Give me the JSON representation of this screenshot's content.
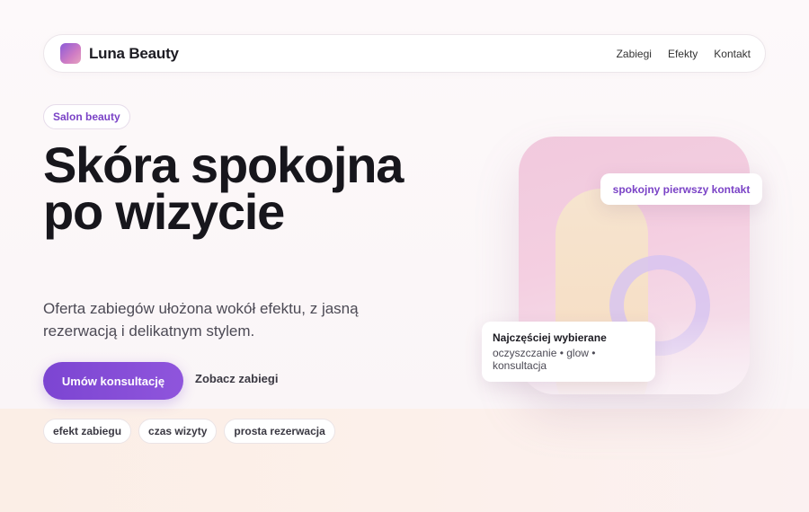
{
  "brand": {
    "name": "Luna Beauty"
  },
  "nav": {
    "links": [
      "Zabiegi",
      "Efekty",
      "Kontakt"
    ]
  },
  "hero": {
    "badge": "Salon beauty",
    "headline": "Skóra spokojna po wizycie",
    "subtitle": "Oferta zabiegów ułożona wokół efektu, z jasną rezerwacją i delikatnym stylem.",
    "cta_primary": "Umów konsultację",
    "cta_secondary": "Zobacz zabiegi",
    "chips": [
      "efekt zabiegu",
      "czas wizyty",
      "prosta rezerwacja"
    ]
  },
  "visual": {
    "top_card": "spokojny pierwszy kontakt",
    "bottom_card": {
      "title": "Najczęściej wybierane",
      "text": "oczyszczanie • glow • konsultacja"
    }
  },
  "colors": {
    "accent": "#7c45d2",
    "accent_text": "#7a42c6",
    "headline": "#17161c"
  }
}
